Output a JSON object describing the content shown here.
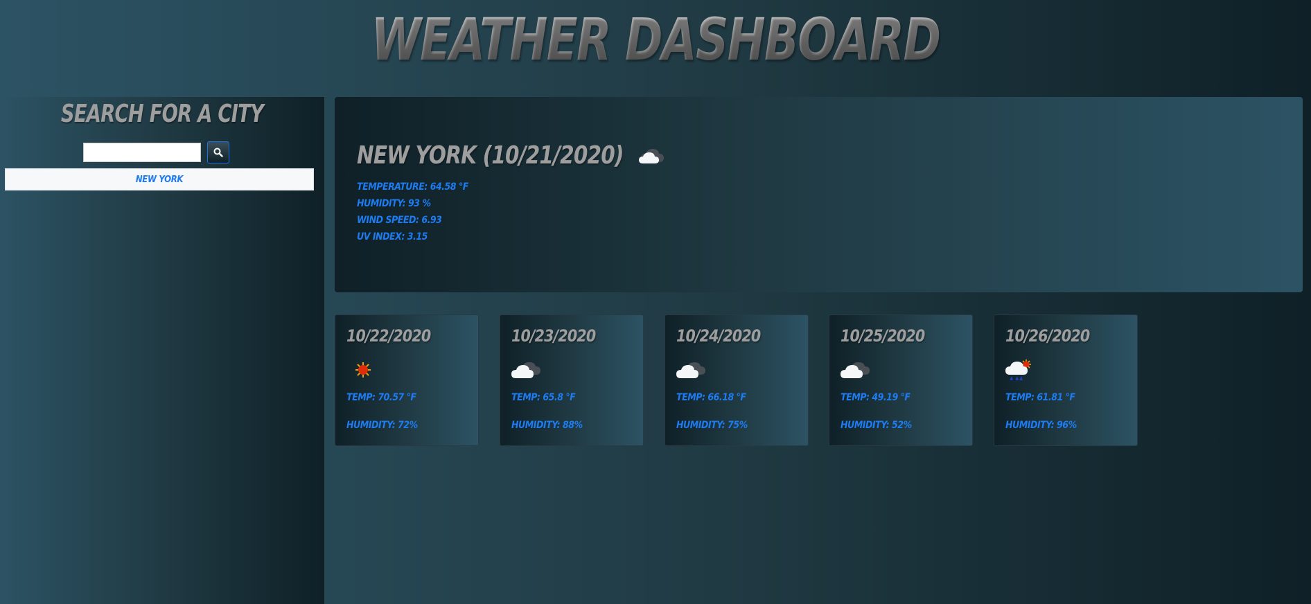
{
  "header": {
    "title": "Weather Dashboard"
  },
  "sidebar": {
    "title": "Search for a city",
    "search": {
      "value": "",
      "placeholder": ""
    },
    "search_button_icon": "search-icon",
    "history": [
      "New York"
    ]
  },
  "current": {
    "city": "New York",
    "date": "(10/21/2020)",
    "icon": "cloud-icon",
    "temperature": "Temperature: 64.58 °F",
    "humidity": "Humidity: 93 %",
    "wind_speed": "Wind Speed: 6.93",
    "uv_index": "UV Index: 3.15"
  },
  "forecast": [
    {
      "date": "10/22/2020",
      "icon": "sun-icon",
      "temp": "Temp: 70.57 °F",
      "humidity": "Humidity: 72%"
    },
    {
      "date": "10/23/2020",
      "icon": "cloud-icon",
      "temp": "Temp: 65.8 °F",
      "humidity": "Humidity: 88%"
    },
    {
      "date": "10/24/2020",
      "icon": "cloud-icon",
      "temp": "Temp: 66.18 °F",
      "humidity": "Humidity: 75%"
    },
    {
      "date": "10/25/2020",
      "icon": "cloud-icon",
      "temp": "Temp: 49.19 °F",
      "humidity": "Humidity: 52%"
    },
    {
      "date": "10/26/2020",
      "icon": "rain-sun-icon",
      "temp": "Temp: 61.81 °F",
      "humidity": "Humidity: 96%"
    }
  ],
  "colors": {
    "accent": "#1e7bf0",
    "heading": "#9e9e9e"
  }
}
